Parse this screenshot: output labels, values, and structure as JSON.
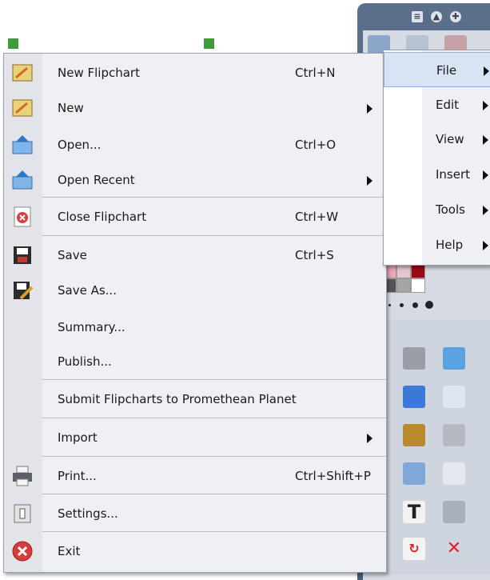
{
  "file_menu": {
    "items": [
      {
        "label": "New Flipchart",
        "shortcut": "Ctrl+N",
        "icon": "flipchart-icon"
      },
      {
        "label": "New",
        "shortcut": "",
        "submenu": true,
        "icon": "new-flipchart-icon"
      },
      {
        "label": "Open...",
        "shortcut": "Ctrl+O",
        "icon": "open-icon"
      },
      {
        "label": "Open Recent",
        "shortcut": "",
        "submenu": true,
        "icon": "open-recent-icon"
      },
      {
        "label": "Close Flipchart",
        "shortcut": "Ctrl+W",
        "icon": "close-flipchart-icon"
      },
      {
        "label": "Save",
        "shortcut": "Ctrl+S",
        "icon": "save-icon"
      },
      {
        "label": "Save As...",
        "shortcut": "",
        "icon": "save-as-icon"
      },
      {
        "label": "Summary...",
        "shortcut": "",
        "icon": ""
      },
      {
        "label": "Publish...",
        "shortcut": "",
        "icon": ""
      },
      {
        "label": "Submit Flipcharts to Promethean Planet",
        "shortcut": "",
        "icon": ""
      },
      {
        "label": "Import",
        "shortcut": "",
        "submenu": true,
        "icon": ""
      },
      {
        "label": "Print...",
        "shortcut": "Ctrl+Shift+P",
        "icon": "printer-icon"
      },
      {
        "label": "Settings...",
        "shortcut": "",
        "icon": "settings-icon"
      },
      {
        "label": "Exit",
        "shortcut": "",
        "icon": "exit-icon"
      }
    ]
  },
  "menu_bar": {
    "items": [
      {
        "label": "File",
        "active": true
      },
      {
        "label": "Edit"
      },
      {
        "label": "View"
      },
      {
        "label": "Insert"
      },
      {
        "label": "Tools"
      },
      {
        "label": "Help"
      }
    ]
  },
  "colors": {
    "toolbox": "#4f6582",
    "menu_bg": "#eff0f4",
    "accent_red": "#d93c3c",
    "handle_green": "#3f9a3a"
  }
}
